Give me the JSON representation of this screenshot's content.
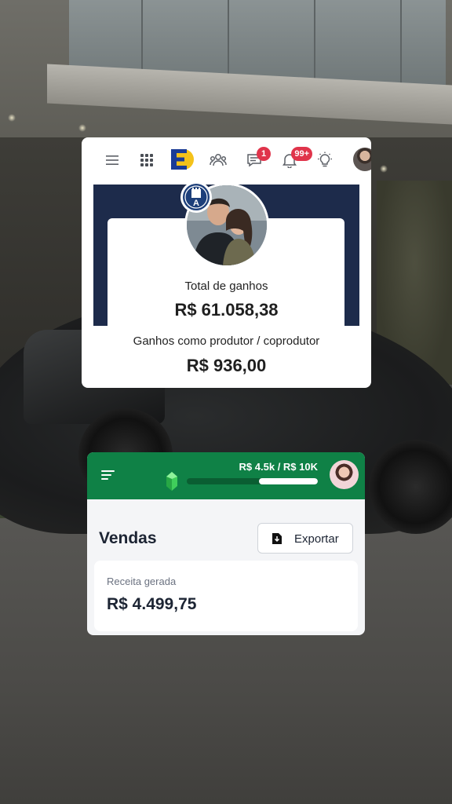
{
  "earnings_card": {
    "nav": {
      "icons": [
        "menu-icon",
        "apps-grid-icon",
        "brand-logo",
        "people-icon",
        "chat-icon",
        "bell-icon",
        "lightbulb-icon",
        "avatar"
      ],
      "chat_badge": "1",
      "notifications_badge": "99+",
      "brand_color": "#1b3c96",
      "brand_accent": "#f4c21a",
      "badge_color": "#e0344b"
    },
    "level_badge_letter": "A",
    "total_label": "Total de ganhos",
    "total_value": "R$ 61.058,38",
    "producer_label": "Ganhos como produtor / coprodutor",
    "producer_value": "R$ 936,00",
    "cover_color": "#1d2b4b"
  },
  "sales_card": {
    "progress_text": "R$ 4.5k / R$ 10K",
    "progress_fraction": 0.45,
    "header_color": "#0f8146",
    "title": "Vendas",
    "export_label": "Exportar",
    "revenue_label": "Receita gerada",
    "revenue_value": "R$ 4.499,75"
  }
}
